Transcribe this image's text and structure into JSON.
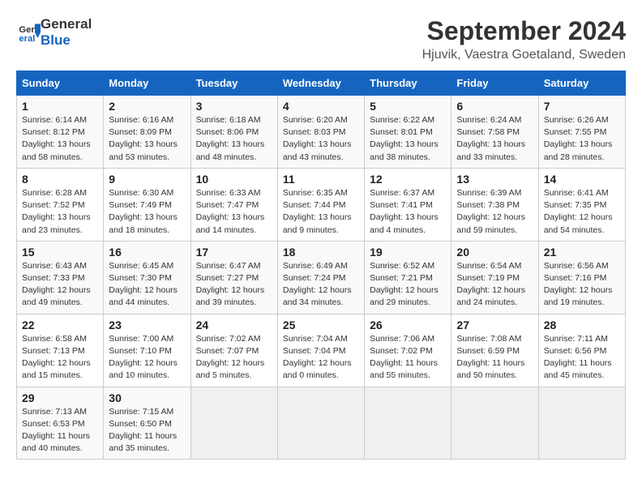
{
  "header": {
    "logo_general": "General",
    "logo_blue": "Blue",
    "title": "September 2024",
    "subtitle": "Hjuvik, Vaestra Goetaland, Sweden"
  },
  "weekdays": [
    "Sunday",
    "Monday",
    "Tuesday",
    "Wednesday",
    "Thursday",
    "Friday",
    "Saturday"
  ],
  "weeks": [
    [
      {
        "day": "1",
        "info": "Sunrise: 6:14 AM\nSunset: 8:12 PM\nDaylight: 13 hours\nand 58 minutes."
      },
      {
        "day": "2",
        "info": "Sunrise: 6:16 AM\nSunset: 8:09 PM\nDaylight: 13 hours\nand 53 minutes."
      },
      {
        "day": "3",
        "info": "Sunrise: 6:18 AM\nSunset: 8:06 PM\nDaylight: 13 hours\nand 48 minutes."
      },
      {
        "day": "4",
        "info": "Sunrise: 6:20 AM\nSunset: 8:03 PM\nDaylight: 13 hours\nand 43 minutes."
      },
      {
        "day": "5",
        "info": "Sunrise: 6:22 AM\nSunset: 8:01 PM\nDaylight: 13 hours\nand 38 minutes."
      },
      {
        "day": "6",
        "info": "Sunrise: 6:24 AM\nSunset: 7:58 PM\nDaylight: 13 hours\nand 33 minutes."
      },
      {
        "day": "7",
        "info": "Sunrise: 6:26 AM\nSunset: 7:55 PM\nDaylight: 13 hours\nand 28 minutes."
      }
    ],
    [
      {
        "day": "8",
        "info": "Sunrise: 6:28 AM\nSunset: 7:52 PM\nDaylight: 13 hours\nand 23 minutes."
      },
      {
        "day": "9",
        "info": "Sunrise: 6:30 AM\nSunset: 7:49 PM\nDaylight: 13 hours\nand 18 minutes."
      },
      {
        "day": "10",
        "info": "Sunrise: 6:33 AM\nSunset: 7:47 PM\nDaylight: 13 hours\nand 14 minutes."
      },
      {
        "day": "11",
        "info": "Sunrise: 6:35 AM\nSunset: 7:44 PM\nDaylight: 13 hours\nand 9 minutes."
      },
      {
        "day": "12",
        "info": "Sunrise: 6:37 AM\nSunset: 7:41 PM\nDaylight: 13 hours\nand 4 minutes."
      },
      {
        "day": "13",
        "info": "Sunrise: 6:39 AM\nSunset: 7:38 PM\nDaylight: 12 hours\nand 59 minutes."
      },
      {
        "day": "14",
        "info": "Sunrise: 6:41 AM\nSunset: 7:35 PM\nDaylight: 12 hours\nand 54 minutes."
      }
    ],
    [
      {
        "day": "15",
        "info": "Sunrise: 6:43 AM\nSunset: 7:33 PM\nDaylight: 12 hours\nand 49 minutes."
      },
      {
        "day": "16",
        "info": "Sunrise: 6:45 AM\nSunset: 7:30 PM\nDaylight: 12 hours\nand 44 minutes."
      },
      {
        "day": "17",
        "info": "Sunrise: 6:47 AM\nSunset: 7:27 PM\nDaylight: 12 hours\nand 39 minutes."
      },
      {
        "day": "18",
        "info": "Sunrise: 6:49 AM\nSunset: 7:24 PM\nDaylight: 12 hours\nand 34 minutes."
      },
      {
        "day": "19",
        "info": "Sunrise: 6:52 AM\nSunset: 7:21 PM\nDaylight: 12 hours\nand 29 minutes."
      },
      {
        "day": "20",
        "info": "Sunrise: 6:54 AM\nSunset: 7:19 PM\nDaylight: 12 hours\nand 24 minutes."
      },
      {
        "day": "21",
        "info": "Sunrise: 6:56 AM\nSunset: 7:16 PM\nDaylight: 12 hours\nand 19 minutes."
      }
    ],
    [
      {
        "day": "22",
        "info": "Sunrise: 6:58 AM\nSunset: 7:13 PM\nDaylight: 12 hours\nand 15 minutes."
      },
      {
        "day": "23",
        "info": "Sunrise: 7:00 AM\nSunset: 7:10 PM\nDaylight: 12 hours\nand 10 minutes."
      },
      {
        "day": "24",
        "info": "Sunrise: 7:02 AM\nSunset: 7:07 PM\nDaylight: 12 hours\nand 5 minutes."
      },
      {
        "day": "25",
        "info": "Sunrise: 7:04 AM\nSunset: 7:04 PM\nDaylight: 12 hours\nand 0 minutes."
      },
      {
        "day": "26",
        "info": "Sunrise: 7:06 AM\nSunset: 7:02 PM\nDaylight: 11 hours\nand 55 minutes."
      },
      {
        "day": "27",
        "info": "Sunrise: 7:08 AM\nSunset: 6:59 PM\nDaylight: 11 hours\nand 50 minutes."
      },
      {
        "day": "28",
        "info": "Sunrise: 7:11 AM\nSunset: 6:56 PM\nDaylight: 11 hours\nand 45 minutes."
      }
    ],
    [
      {
        "day": "29",
        "info": "Sunrise: 7:13 AM\nSunset: 6:53 PM\nDaylight: 11 hours\nand 40 minutes."
      },
      {
        "day": "30",
        "info": "Sunrise: 7:15 AM\nSunset: 6:50 PM\nDaylight: 11 hours\nand 35 minutes."
      },
      {
        "day": "",
        "info": ""
      },
      {
        "day": "",
        "info": ""
      },
      {
        "day": "",
        "info": ""
      },
      {
        "day": "",
        "info": ""
      },
      {
        "day": "",
        "info": ""
      }
    ]
  ]
}
